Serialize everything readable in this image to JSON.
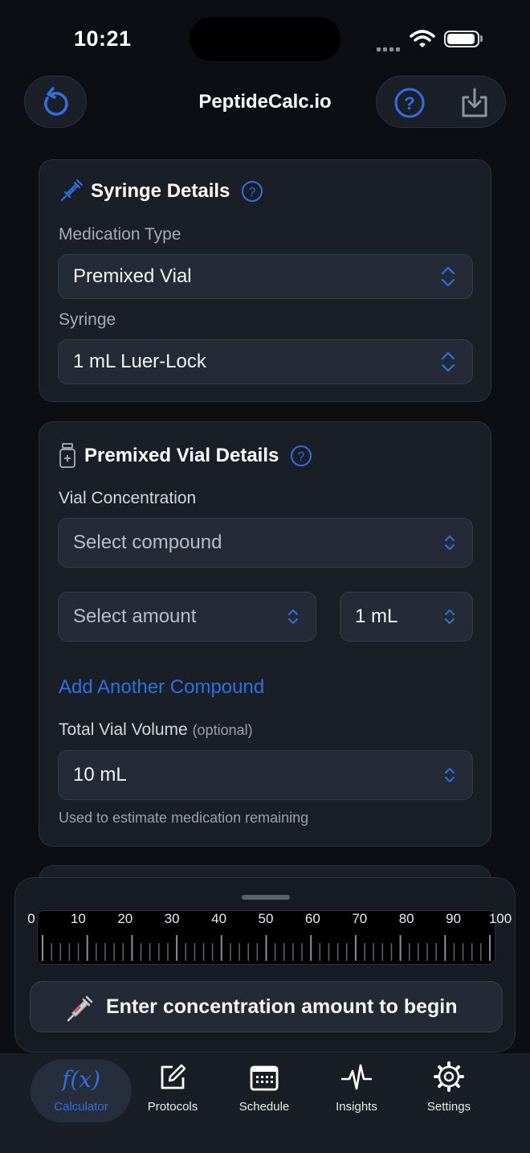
{
  "status": {
    "time": "10:21"
  },
  "nav": {
    "title": "PeptideCalc.io"
  },
  "syringe_card": {
    "title": "Syringe Details",
    "medication_type_label": "Medication Type",
    "medication_type_value": "Premixed Vial",
    "syringe_label": "Syringe",
    "syringe_value": "1 mL Luer-Lock"
  },
  "vial_card": {
    "title": "Premixed Vial Details",
    "concentration_label": "Vial Concentration",
    "compound_placeholder": "Select compound",
    "amount_placeholder": "Select amount",
    "unit_value": "1 mL",
    "add_compound": "Add Another Compound",
    "total_volume_label": "Total Vial Volume",
    "total_volume_optional": "(optional)",
    "total_volume_value": "10 mL",
    "total_volume_hint": "Used to estimate medication remaining"
  },
  "ruler": {
    "ticks": [
      "0",
      "10",
      "20",
      "30",
      "40",
      "50",
      "60",
      "70",
      "80",
      "90",
      "100"
    ]
  },
  "cta": {
    "label": "Enter concentration amount to begin"
  },
  "tabs": [
    {
      "label": "Calculator",
      "icon": "function-icon",
      "active": true
    },
    {
      "label": "Protocols",
      "icon": "edit-icon"
    },
    {
      "label": "Schedule",
      "icon": "calendar-icon"
    },
    {
      "label": "Insights",
      "icon": "pulse-icon"
    },
    {
      "label": "Settings",
      "icon": "gear-icon"
    }
  ],
  "colors": {
    "accent": "#2f6fe0",
    "background": "#0c0e13",
    "card": "#1a1e27"
  }
}
